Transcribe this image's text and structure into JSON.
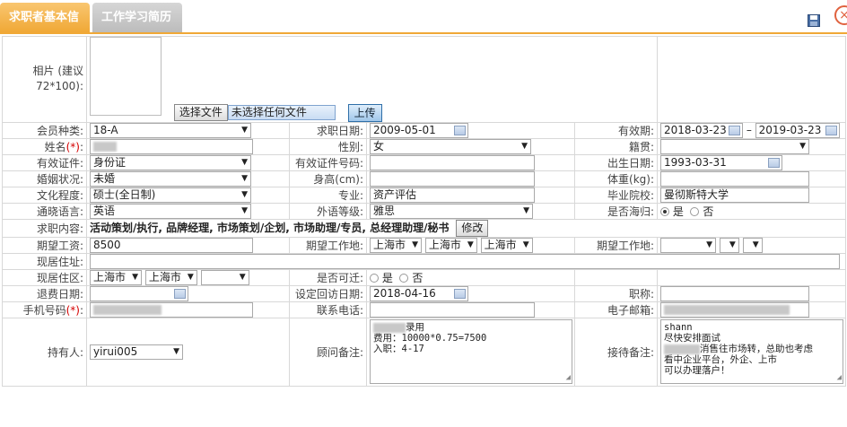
{
  "tabs": {
    "basic_info": "求职者基本信息",
    "work_history": "工作学习简历"
  },
  "icons": {
    "save": "save-icon",
    "close": "close-icon"
  },
  "colors": {
    "active_tab": "#f0a836",
    "inactive_tab": "#bcbcbc",
    "required_mark": "#d40000",
    "upload_button": "#9fc6ea"
  },
  "photo": {
    "label": "相片 (建议72*100):",
    "choose_file": "选择文件",
    "no_file": "未选择任何文件",
    "upload": "上传"
  },
  "labels": {
    "member_type": "会员种类:",
    "apply_date": "求职日期:",
    "valid_period": "有效期:",
    "name": "姓名",
    "required_mark": "(*)",
    "colon": ":",
    "gender": "性别:",
    "native_place": "籍贯:",
    "id_type": "有效证件:",
    "id_number": "有效证件号码:",
    "birth_date": "出生日期:",
    "marital": "婚姻状况:",
    "height": "身高(cm):",
    "weight": "体重(kg):",
    "education": "文化程度:",
    "major": "专业:",
    "school": "毕业院校:",
    "language": "通晓语言:",
    "language_level": "外语等级:",
    "overseas": "是否海归:",
    "job_content": "求职内容:",
    "expected_salary": "期望工资:",
    "expected_location": "期望工作地:",
    "current_address": "现居住址:",
    "current_area": "现居住区:",
    "relocate": "是否可迁:",
    "refund_date": "退费日期:",
    "revisit_date": "设定回访日期:",
    "title": "职称:",
    "mobile": "手机号码",
    "contact_phone": "联系电话:",
    "email": "电子邮箱:",
    "holder": "持有人:",
    "consultant_note": "顾问备注:",
    "reception_note": "接待备注:",
    "yes": "是",
    "no": "否",
    "dash": "–"
  },
  "values": {
    "member_type": "18-A",
    "apply_date": "2009-05-01",
    "valid_from": "2018-03-23",
    "valid_to": "2019-03-23",
    "gender": "女",
    "native_place": "",
    "id_type": "身份证",
    "id_number": "",
    "birth_date": "1993-03-31",
    "marital": "未婚",
    "height": "",
    "weight": "",
    "education": "硕士(全日制)",
    "major": "资产评估",
    "school": "曼彻斯特大学",
    "language": "英语",
    "language_level": "雅思",
    "overseas_selected": "是",
    "job_content": "活动策划/执行, 品牌经理, 市场策划/企划, 市场助理/专员, 总经理助理/秘书",
    "modify_button": "修改",
    "expected_salary": "8500",
    "expected_city_1": "上海市",
    "expected_city_2": "上海市",
    "expected_city_3": "上海市",
    "current_address": "",
    "current_city_1": "上海市",
    "current_city_2": "上海市",
    "current_city_3": "",
    "refund_date": "",
    "revisit_date": "2018-04-16",
    "title": "",
    "contact_phone": "",
    "holder": "yirui005",
    "consultant_note_line1": "录用",
    "consultant_note_rest": "费用：10000*0.75=7500\n入职：4-17",
    "reception_note_line1": "shann",
    "reception_note_line2": "尽快安排面试",
    "reception_note_line3": "消售往市场转，总助也考虑",
    "reception_note_rest": "看中企业平台，外企、上市\n可以办理落户！"
  }
}
